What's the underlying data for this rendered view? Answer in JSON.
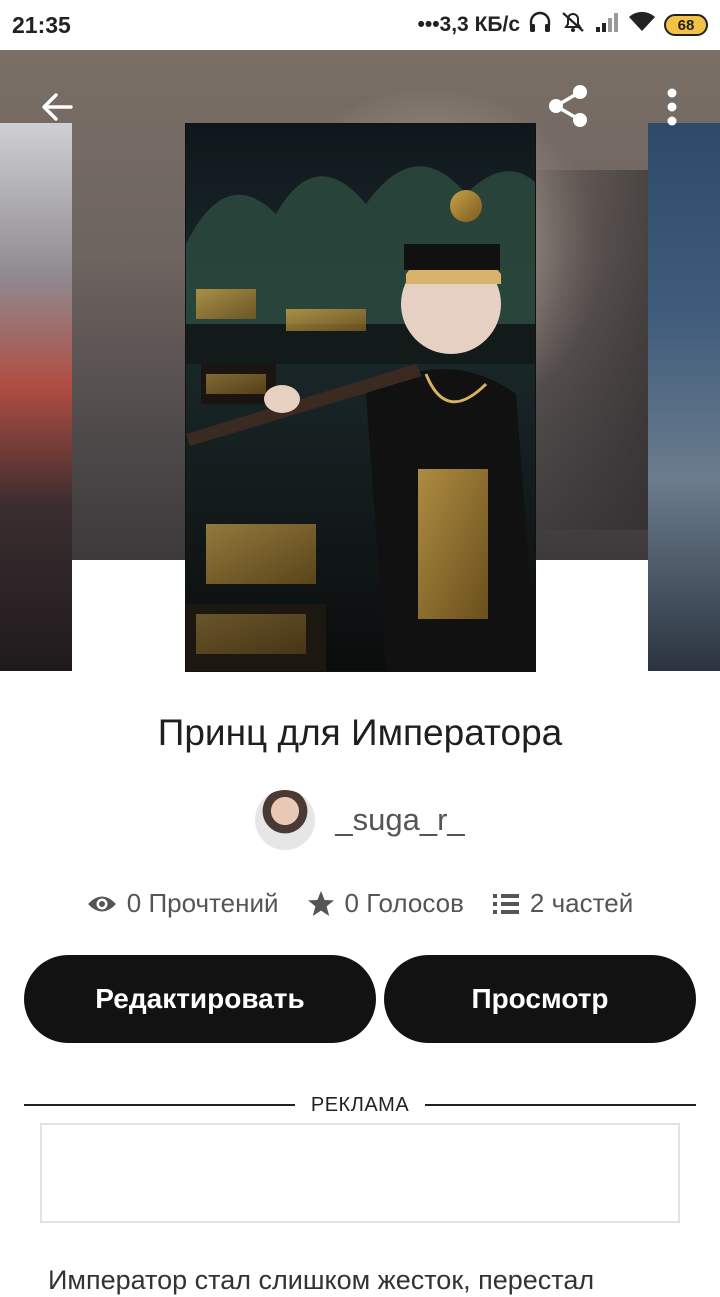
{
  "status_bar": {
    "time": "21:35",
    "network_speed": "•••3,3 КБ/с",
    "battery_level": "68",
    "icons": [
      "headphones-icon",
      "mute-icon",
      "signal-icon",
      "wifi-icon",
      "battery-icon"
    ]
  },
  "header": {
    "back_icon": "arrow-left-icon",
    "share_icon": "share-icon",
    "menu_icon": "more-vertical-icon"
  },
  "story": {
    "title": "Принц для Императора",
    "author": "_suga_r_",
    "stats": {
      "reads": "0 Прочтений",
      "votes": "0 Голосов",
      "parts": "2 частей"
    },
    "description_preview": "Император стал слишком жесток, перестал"
  },
  "actions": {
    "edit_label": "Редактировать",
    "view_label": "Просмотр"
  },
  "ad": {
    "label": "РЕКЛАМА"
  },
  "colors": {
    "button_bg": "#121212",
    "button_text": "#ffffff",
    "battery_fill": "#f3c245"
  }
}
